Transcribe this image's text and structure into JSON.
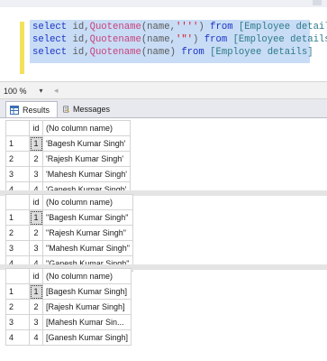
{
  "editor": {
    "line1": {
      "kw1": "select",
      "cols": " id,",
      "fn": "Quotename",
      "open": "(name,",
      "arg": "''''",
      "close": ")",
      "from": " from ",
      "tbl": "[Employee details]"
    },
    "line2": {
      "kw1": "select",
      "cols": " id,",
      "fn": "Quotename",
      "open": "(name,",
      "arg": "'\"'",
      "close": ")",
      "from": " from ",
      "tbl": "[Employee details]"
    },
    "line3": {
      "kw1": "select",
      "cols": " id,",
      "fn": "Quotename",
      "open": "(name)",
      "from": " from ",
      "tbl": "[Employee details]"
    }
  },
  "zoom": {
    "value": "100 %"
  },
  "tabs": [
    {
      "label": "Results",
      "icon": "grid-icon"
    },
    {
      "label": "Messages",
      "icon": "messages-icon"
    }
  ],
  "grids": [
    {
      "headers": [
        "",
        "id",
        "(No column name)"
      ],
      "rows": [
        {
          "rownum": "1",
          "id": "1",
          "name": "'Bagesh Kumar Singh'"
        },
        {
          "rownum": "2",
          "id": "2",
          "name": "'Rajesh Kumar Singh'"
        },
        {
          "rownum": "3",
          "id": "3",
          "name": "'Mahesh Kumar Singh'"
        },
        {
          "rownum": "4",
          "id": "4",
          "name": "'Ganesh Kumar Singh'"
        }
      ]
    },
    {
      "headers": [
        "",
        "id",
        "(No column name)"
      ],
      "rows": [
        {
          "rownum": "1",
          "id": "1",
          "name": "\"Bagesh Kumar Singh\""
        },
        {
          "rownum": "2",
          "id": "2",
          "name": "\"Rajesh Kumar Singh\""
        },
        {
          "rownum": "3",
          "id": "3",
          "name": "\"Mahesh Kumar Singh\""
        },
        {
          "rownum": "4",
          "id": "4",
          "name": "\"Ganesh Kumar Singh\""
        }
      ]
    },
    {
      "headers": [
        "",
        "id",
        "(No column name)"
      ],
      "rows": [
        {
          "rownum": "1",
          "id": "1",
          "name": "[Bagesh Kumar Singh]"
        },
        {
          "rownum": "2",
          "id": "2",
          "name": "[Rajesh Kumar Singh]"
        },
        {
          "rownum": "3",
          "id": "3",
          "name": "[Mahesh Kumar Sin..."
        },
        {
          "rownum": "4",
          "id": "4",
          "name": "[Ganesh Kumar Singh]"
        }
      ]
    }
  ]
}
